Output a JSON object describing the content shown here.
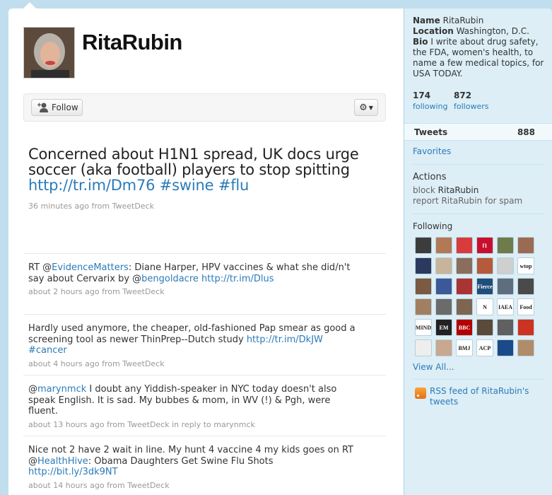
{
  "profile": {
    "screen_name": "RitaRubin",
    "follow_label": "Follow"
  },
  "latest": {
    "text": "Concerned about H1N1 spread, UK docs urge soccer (aka football) players to stop spitting ",
    "link": "http://tr.im/Dm76",
    "tags": [
      "#swine",
      "#flu"
    ],
    "time": "36 minutes ago",
    "from": "from",
    "source": "TweetDeck"
  },
  "tweets": [
    {
      "parts": [
        "RT @",
        "EvidenceMatters",
        ": Diane Harper, HPV vaccines & what she did/n't say about Cervarix by @",
        "bengoldacre",
        " ",
        "http://tr.im/Dlus"
      ],
      "time": "about 2 hours ago",
      "source": "TweetDeck"
    },
    {
      "parts": [
        "Hardly used anymore, the cheaper, old-fashioned Pap smear as good a screening tool as newer ThinPrep--Dutch study ",
        "http://tr.im/DkJW",
        " ",
        "#cancer"
      ],
      "time": "about 4 hours ago",
      "source": "TweetDeck"
    },
    {
      "parts": [
        "@",
        "marynmck",
        " I doubt any Yiddish-speaker in NYC today doesn't also speak English. It is sad. My bubbes & mom, in WV (!) & Pgh, were fluent."
      ],
      "time": "about 13 hours ago",
      "source": "TweetDeck",
      "reply_text": "in reply to",
      "reply_to": "marynmck"
    },
    {
      "parts": [
        "Nice not 2 have 2 wait in line. My hunt 4 vaccine 4 my kids goes on RT @",
        "HealthHive",
        ": Obama Daughters Get Swine Flu Shots ",
        "http://bit.ly/3dk9NT"
      ],
      "time": "about 14 hours ago",
      "source": "TweetDeck"
    }
  ],
  "sidebar": {
    "name_label": "Name",
    "name": "RitaRubin",
    "location_label": "Location",
    "location": "Washington, D.C.",
    "bio_label": "Bio",
    "bio": "I write about drug safety, the FDA, women's health, to name a few medical topics, for USA TODAY.",
    "following_count": "174",
    "following_label": "following",
    "followers_count": "872",
    "followers_label": "followers",
    "tweets_label": "Tweets",
    "tweets_count": "888",
    "favorites": "Favorites",
    "actions_heading": "Actions",
    "block": "block",
    "block_name": "RitaRubin",
    "report": "report RitaRubin for spam",
    "following_heading": "Following",
    "view_all": "View All...",
    "rss": "RSS feed of RitaRubin's tweets",
    "following_avatars": [
      {
        "label": "",
        "bg": "#3c3c3c"
      },
      {
        "label": "",
        "bg": "#b07a55"
      },
      {
        "label": "",
        "bg": "#d83b3b"
      },
      {
        "label": "f1",
        "bg": "#c8102e"
      },
      {
        "label": "",
        "bg": "#6e7b4a"
      },
      {
        "label": "",
        "bg": "#9a6b53"
      },
      {
        "label": "",
        "bg": "#2a3a5e"
      },
      {
        "label": "",
        "bg": "#c8b49a"
      },
      {
        "label": "",
        "bg": "#8a6e5c"
      },
      {
        "label": "",
        "bg": "#b55a3a"
      },
      {
        "label": "",
        "bg": "#cfcfcf"
      },
      {
        "label": "wtop",
        "bg": "#ffffff"
      },
      {
        "label": "",
        "bg": "#7a5a40"
      },
      {
        "label": "",
        "bg": "#3b5998"
      },
      {
        "label": "",
        "bg": "#aa3333"
      },
      {
        "label": "Fierce",
        "bg": "#1f4e79"
      },
      {
        "label": "",
        "bg": "#5d6e7e"
      },
      {
        "label": "",
        "bg": "#4a4a4a"
      },
      {
        "label": "",
        "bg": "#a08060"
      },
      {
        "label": "",
        "bg": "#6b6b6b"
      },
      {
        "label": "",
        "bg": "#7d6650"
      },
      {
        "label": "N",
        "bg": "#ffffff"
      },
      {
        "label": "IAEA",
        "bg": "#ffffff"
      },
      {
        "label": "Food",
        "bg": "#ffffff"
      },
      {
        "label": "MIND",
        "bg": "#ffffff"
      },
      {
        "label": "EM",
        "bg": "#222222"
      },
      {
        "label": "BBC",
        "bg": "#b30000"
      },
      {
        "label": "",
        "bg": "#5a4a3a"
      },
      {
        "label": "",
        "bg": "#606060"
      },
      {
        "label": "",
        "bg": "#cc3322"
      },
      {
        "label": "",
        "bg": "#eeeeee"
      },
      {
        "label": "",
        "bg": "#c9a890"
      },
      {
        "label": "BMJ",
        "bg": "#ffffff"
      },
      {
        "label": "ACP",
        "bg": "#ffffff"
      },
      {
        "label": "",
        "bg": "#1a4a8a"
      },
      {
        "label": "",
        "bg": "#b08d6a"
      }
    ]
  },
  "colors": {
    "page_bg": "#c0deed",
    "link": "#2b7bb9",
    "sidebar_bg": "#ddeef6"
  }
}
